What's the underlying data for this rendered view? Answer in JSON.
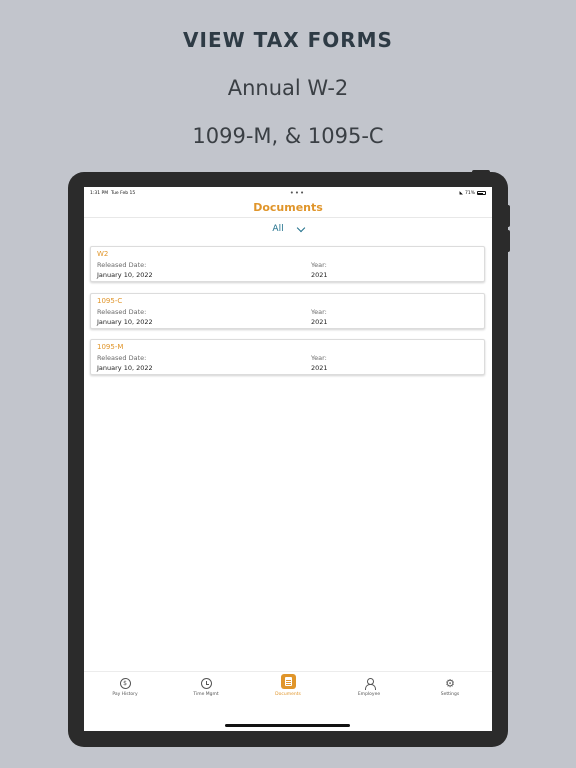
{
  "promo": {
    "title": "VIEW TAX FORMS",
    "line1": "Annual W-2",
    "line2": "1099-M, & 1095-C"
  },
  "statusbar": {
    "time": "1:31 PM",
    "date": "Tue Feb 15",
    "battery": "71%"
  },
  "header": {
    "title": "Documents"
  },
  "filter": {
    "selected": "All"
  },
  "labels": {
    "released_date": "Released Date:",
    "year": "Year:"
  },
  "documents": [
    {
      "name": "W2",
      "released_date": "January 10, 2022",
      "year": "2021"
    },
    {
      "name": "1095-C",
      "released_date": "January 10, 2022",
      "year": "2021"
    },
    {
      "name": "1095-M",
      "released_date": "January 10, 2022",
      "year": "2021"
    }
  ],
  "tabbar": {
    "items": [
      {
        "label": "Pay History",
        "icon": "dollar-circle-icon"
      },
      {
        "label": "Time Mgmt",
        "icon": "clock-icon"
      },
      {
        "label": "Documents",
        "icon": "document-icon"
      },
      {
        "label": "Employee",
        "icon": "person-icon"
      },
      {
        "label": "Settings",
        "icon": "gear-icon"
      }
    ],
    "active": "Documents"
  },
  "colors": {
    "accent": "#e0952a",
    "link": "#1f6f8b",
    "background": "#c2c5cc",
    "device": "#2b2b2b"
  }
}
